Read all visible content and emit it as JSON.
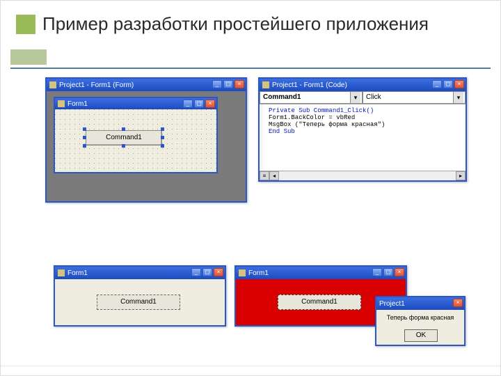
{
  "slide": {
    "title": "Пример разработки простейшего приложения"
  },
  "designer_window": {
    "title": "Project1 - Form1 (Form)",
    "form_title": "Form1",
    "command_button_label": "Command1"
  },
  "code_window": {
    "title": "Project1 - Form1 (Code)",
    "object_dropdown": "Command1",
    "event_dropdown": "Click",
    "code_lines": [
      "Private Sub Command1_Click()",
      "Form1.BackColor = vbRed",
      "MsgBox (\"Теперь форма красная\")",
      "End Sub"
    ]
  },
  "runtime_before": {
    "title": "Form1",
    "button_label": "Command1"
  },
  "runtime_after": {
    "title": "Form1",
    "button_label": "Command1"
  },
  "msgbox": {
    "title": "Project1",
    "message": "Теперь форма красная",
    "ok_label": "OK"
  },
  "colors": {
    "accent_green": "#9bbb59",
    "titlebar_blue": "#2a57c5",
    "form_red": "#d80000"
  }
}
